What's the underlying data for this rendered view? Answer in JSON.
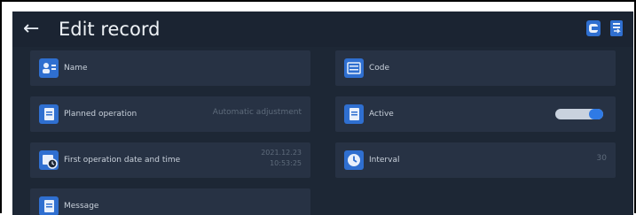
{
  "header": {
    "back_icon": "arrow-left-icon",
    "title": "Edit record"
  },
  "header_icons": [
    "database-icon",
    "export-icon"
  ],
  "fields": {
    "name": {
      "label": "Name",
      "value": "",
      "icon": "user-card-icon"
    },
    "code": {
      "label": "Code",
      "value": "",
      "icon": "code-icon"
    },
    "planned": {
      "label": "Planned operation",
      "value": "Automatic adjustment",
      "icon": "document-icon"
    },
    "active": {
      "label": "Active",
      "value": true,
      "icon": "document-icon"
    },
    "first": {
      "label": "First operation date and time",
      "value_date": "2021.12.23",
      "value_time": "10:53:25",
      "icon": "calendar-clock-icon"
    },
    "interval": {
      "label": "Interval",
      "value": "30",
      "icon": "clock-icon"
    },
    "message": {
      "label": "Message",
      "icon": "message-icon"
    }
  },
  "colors": {
    "accent": "#2f6fd0",
    "background": "#1d2735",
    "panel": "#273244"
  }
}
